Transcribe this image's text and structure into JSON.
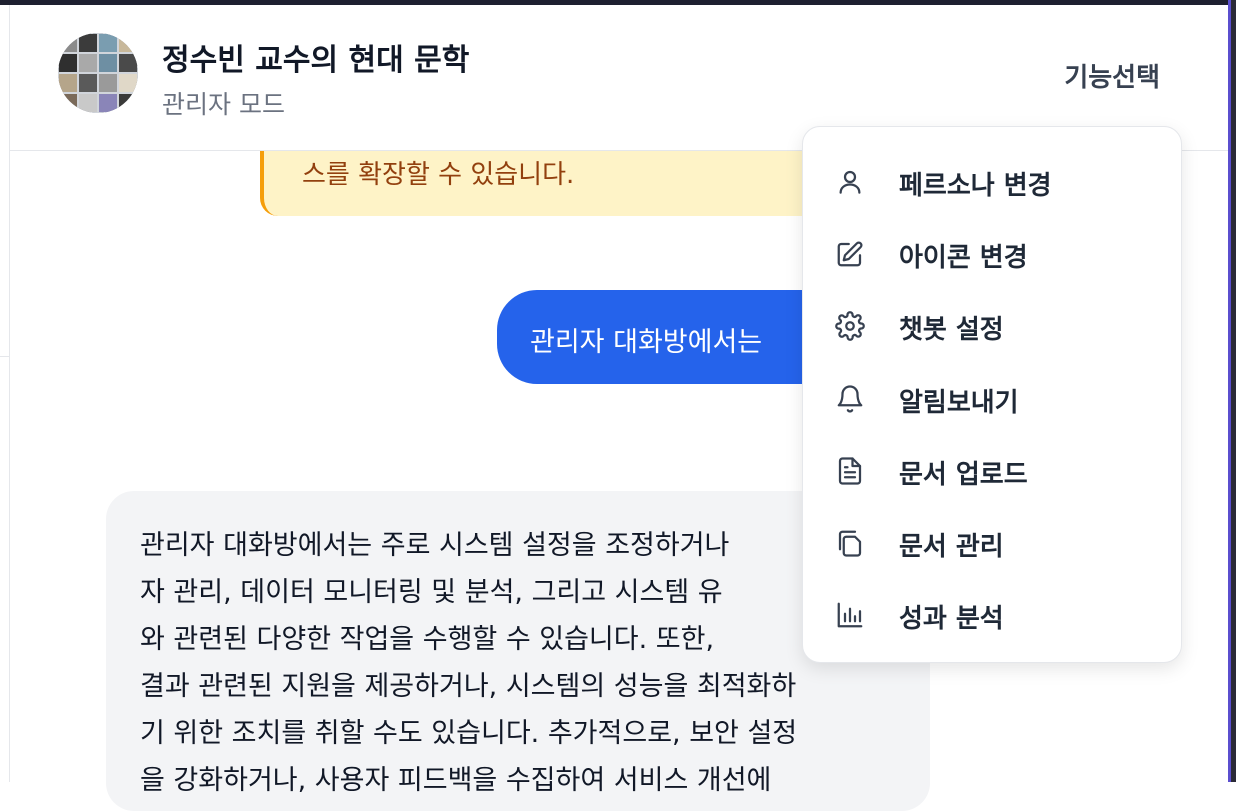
{
  "header": {
    "title": "정수빈 교수의 현대 문학",
    "subtitle": "관리자 모드",
    "feature_button": "기능선택"
  },
  "chat": {
    "note_text": "스를 확장할 수 있습니다.",
    "user_message": "관리자 대화방에서는",
    "bot_lines": [
      "관리자 대화방에서는 주로 시스템 설정을 조정하거나",
      "자 관리, 데이터 모니터링 및 분석, 그리고 시스템 유",
      "와 관련된 다양한 작업을 수행할 수 있습니다. 또한,",
      "결과 관련된 지원을 제공하거나, 시스템의 성능을 최적화하",
      "기 위한 조치를 취할 수도 있습니다. 추가적으로, 보안 설정",
      "을 강화하거나, 사용자 피드백을 수집하여 서비스 개선에"
    ]
  },
  "menu": {
    "items": [
      {
        "label": "페르소나 변경",
        "icon": "user-icon"
      },
      {
        "label": "아이콘 변경",
        "icon": "edit-icon"
      },
      {
        "label": "챗봇 설정",
        "icon": "gear-icon"
      },
      {
        "label": "알림보내기",
        "icon": "bell-icon"
      },
      {
        "label": "문서 업로드",
        "icon": "document-icon"
      },
      {
        "label": "문서 관리",
        "icon": "copy-icon"
      },
      {
        "label": "성과 분석",
        "icon": "bar-chart-icon"
      }
    ]
  },
  "colors": {
    "accent": "#2563eb",
    "note_background": "#fef3c7",
    "note_border": "#f59e0b",
    "note_text": "#92400e",
    "bot_bubble": "#f3f4f6"
  }
}
